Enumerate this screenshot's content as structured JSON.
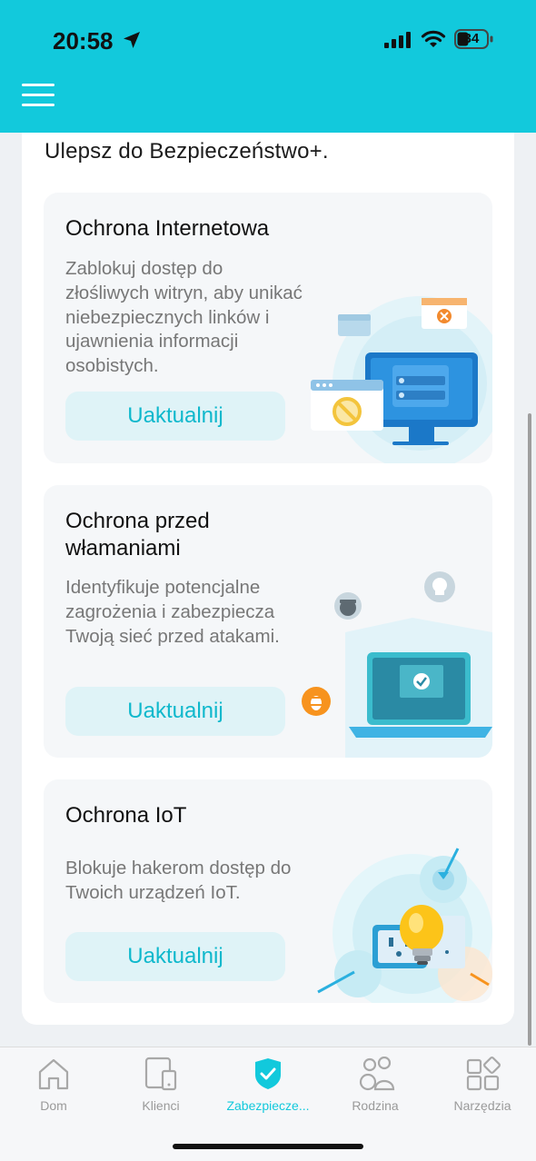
{
  "status_bar": {
    "time": "20:58",
    "battery": "34"
  },
  "intro_text": "Ulepsz do Bezpieczeństwo+.",
  "features": [
    {
      "title": "Ochrona Internetowa",
      "description": "Zablokuj dostęp do złośliwych witryn, aby unikać niebezpiecznych linków i ujawnienia informacji osobistych.",
      "button_label": "Uaktualnij"
    },
    {
      "title": "Ochrona przed włamaniami",
      "description": "Identyfikuje potencjalne zagrożenia i zabezpiecza Twoją sieć przed atakami.",
      "button_label": "Uaktualnij"
    },
    {
      "title": "Ochrona IoT",
      "description": "Blokuje hakerom dostęp do Twoich urządzeń IoT.",
      "button_label": "Uaktualnij"
    }
  ],
  "tabs": [
    {
      "label": "Dom",
      "icon": "home-icon"
    },
    {
      "label": "Klienci",
      "icon": "devices-icon"
    },
    {
      "label": "Zabezpiecze...",
      "icon": "shield-icon",
      "active": true
    },
    {
      "label": "Rodzina",
      "icon": "family-icon"
    },
    {
      "label": "Narzędzia",
      "icon": "tools-icon"
    }
  ],
  "colors": {
    "accent": "#12c9dc",
    "button_bg": "#dff3f7",
    "card_bg": "#f5f7f9"
  }
}
